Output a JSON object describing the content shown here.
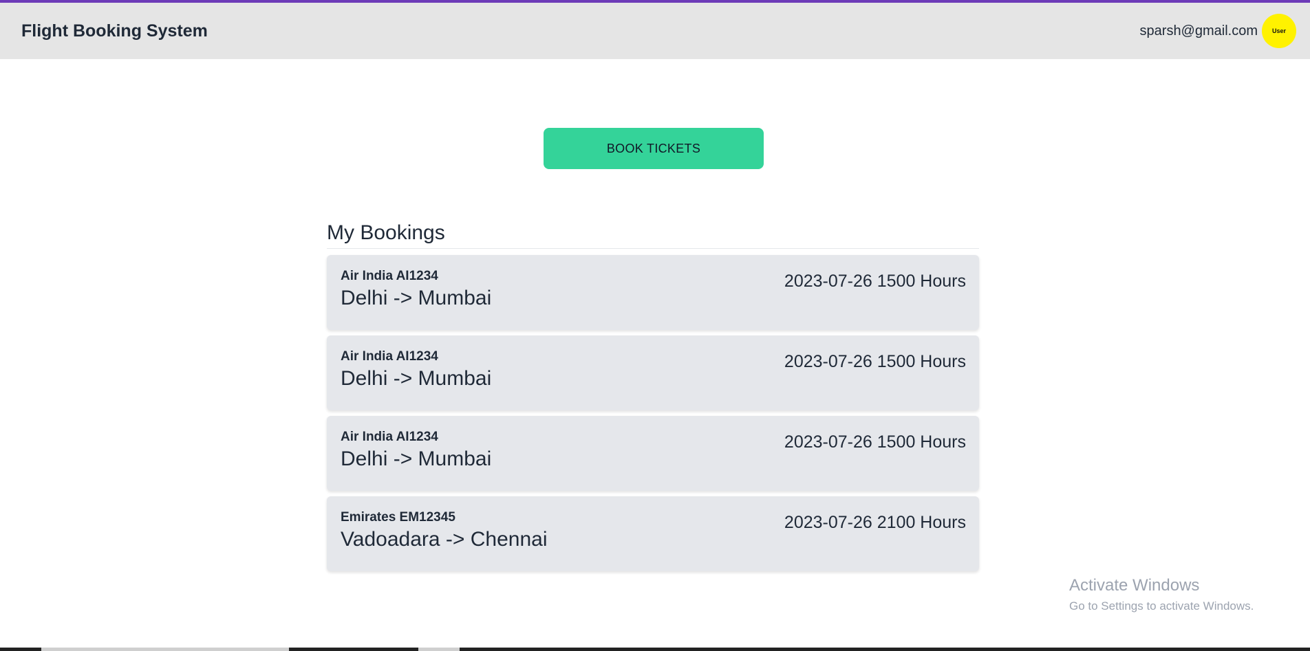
{
  "navbar": {
    "brand": "Flight Booking System",
    "user_email": "sparsh@gmail.com",
    "avatar_label": "User",
    "accent_color": "#6d3bb8"
  },
  "actions": {
    "book_tickets_label": "BOOK TICKETS",
    "button_color": "#34d399"
  },
  "bookings": {
    "title": "My Bookings",
    "items": [
      {
        "flight": "Air India AI1234",
        "route": "Delhi -> Mumbai",
        "datetime": "2023-07-26 1500 Hours"
      },
      {
        "flight": "Air India AI1234",
        "route": "Delhi -> Mumbai",
        "datetime": "2023-07-26 1500 Hours"
      },
      {
        "flight": "Air India AI1234",
        "route": "Delhi -> Mumbai",
        "datetime": "2023-07-26 1500 Hours"
      },
      {
        "flight": "Emirates EM12345",
        "route": "Vadoadara -> Chennai",
        "datetime": "2023-07-26 2100 Hours"
      }
    ]
  },
  "watermark": {
    "title": "Activate Windows",
    "subtitle": "Go to Settings to activate Windows."
  }
}
